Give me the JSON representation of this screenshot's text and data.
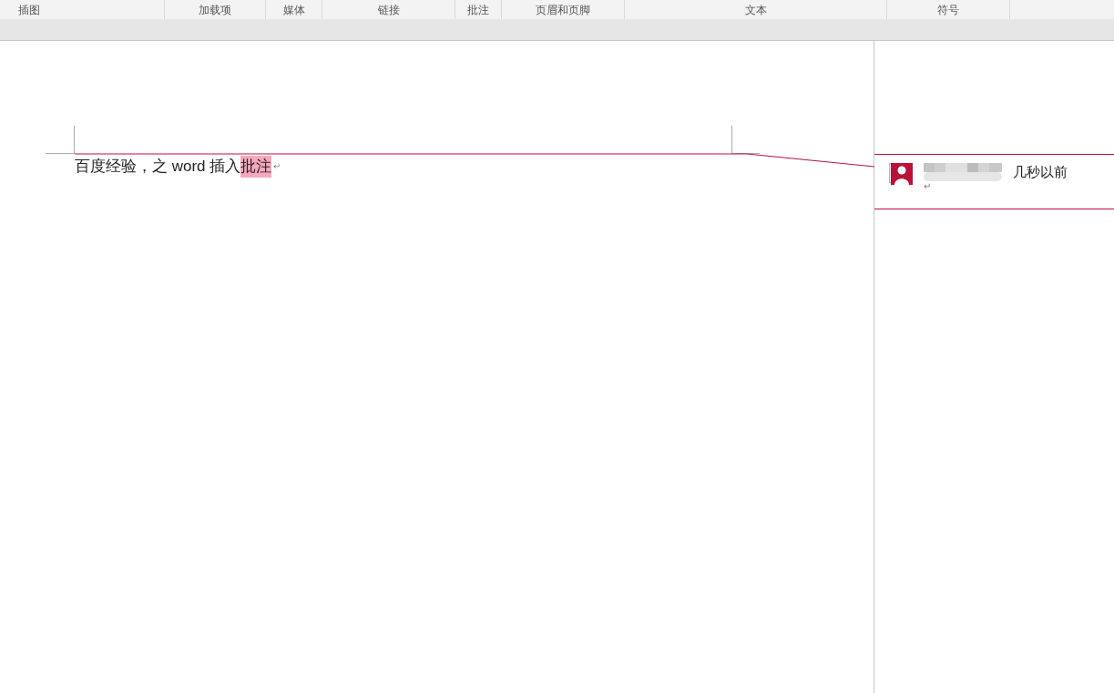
{
  "ribbon_groups": [
    "插图",
    "加载项",
    "媒体",
    "链接",
    "批注",
    "页眉和页脚",
    "文本",
    "符号"
  ],
  "document": {
    "paragraph": {
      "text": "百度经验，之 word 插入",
      "comment_anchor": "批注",
      "mark": "↵"
    }
  },
  "comment": {
    "time": "几秒以前",
    "mark": "↵"
  }
}
